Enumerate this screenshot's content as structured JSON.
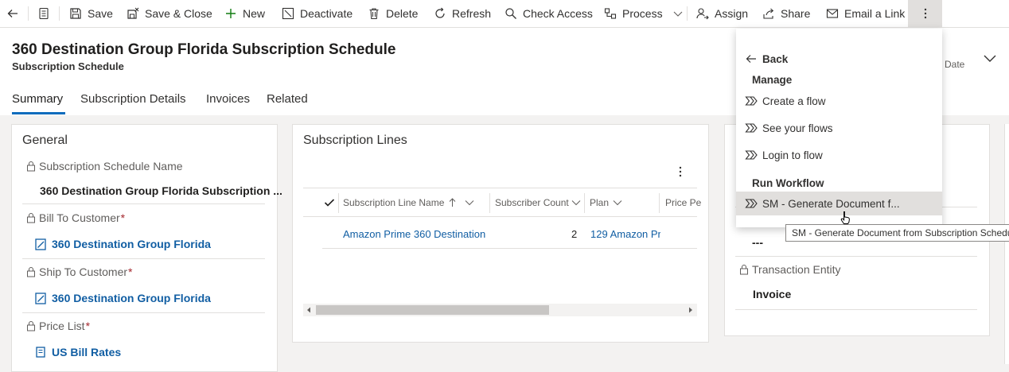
{
  "toolbar": {
    "save": "Save",
    "save_close": "Save & Close",
    "new": "New",
    "deactivate": "Deactivate",
    "delete": "Delete",
    "refresh": "Refresh",
    "check_access": "Check Access",
    "process": "Process",
    "assign": "Assign",
    "share": "Share",
    "email_link": "Email a Link"
  },
  "header": {
    "title": "360 Destination Group Florida Subscription Schedule",
    "subtitle": "Subscription Schedule",
    "right_label": "Date"
  },
  "tabs": [
    "Summary",
    "Subscription Details",
    "Invoices",
    "Related"
  ],
  "general": {
    "title": "General",
    "name_label": "Subscription Schedule Name",
    "name_value": "360 Destination Group Florida Subscription ...",
    "bill_label": "Bill To Customer",
    "bill_value": "360 Destination Group Florida",
    "ship_label": "Ship To Customer",
    "ship_value": "360 Destination Group Florida",
    "price_label": "Price List",
    "price_value": "US Bill Rates",
    "required_mark": "*"
  },
  "lines": {
    "title": "Subscription Lines",
    "columns": [
      "Subscription Line Name",
      "Subscriber Count",
      "Plan",
      "Price Pe"
    ],
    "rows": [
      {
        "name": "Amazon Prime 360 Destination",
        "count": "2",
        "plan": "129 Amazon Pr"
      }
    ]
  },
  "right_panel": {
    "empty_value": "---",
    "entity_label": "Transaction Entity",
    "entity_value": "Invoice"
  },
  "menu": {
    "back": "Back",
    "manage_header": "Manage",
    "create_flow": "Create a flow",
    "see_flows": "See your flows",
    "login_flow": "Login to flow",
    "workflow_header": "Run Workflow",
    "generate_doc": "SM - Generate Document f..."
  },
  "tooltip": "SM - Generate Document from Subscription Schedule"
}
